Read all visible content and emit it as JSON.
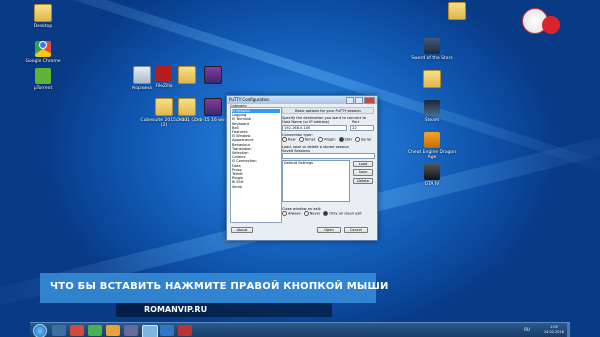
{
  "desktop": {
    "icons": [
      {
        "glyph": "folder",
        "label": "Desktop"
      },
      {
        "glyph": "chrome",
        "label": "Google Chrome"
      },
      {
        "glyph": "utorrent",
        "label": "µTorrent"
      },
      {
        "glyph": "filezilla",
        "label": "FileZilla"
      },
      {
        "glyph": "folder",
        "label": ""
      },
      {
        "glyph": "winrar",
        "label": ""
      },
      {
        "glyph": "folder",
        "label": "Cubesuite 2015.7-13 (2)"
      },
      {
        "glyph": "folder",
        "label": "ceb01 (2)"
      },
      {
        "glyph": "winrar",
        "label": "ceb-15 16 win32"
      },
      {
        "glyph": "recycle",
        "label": "Корзина"
      },
      {
        "glyph": "folder",
        "label": ""
      },
      {
        "glyph": "sword",
        "label": "Sword of the Stars"
      },
      {
        "glyph": "folder",
        "label": ""
      },
      {
        "glyph": "steam",
        "label": "Steam"
      },
      {
        "glyph": "orange",
        "label": "Cheat Engine Dragon Age"
      },
      {
        "glyph": "dark",
        "label": "GTA IV"
      }
    ]
  },
  "putty": {
    "title": "PuTTY Configuration",
    "category_label": "Category:",
    "tree": [
      "⊟ Session",
      "  Logging",
      "⊟ Terminal",
      "  Keyboard",
      "  Bell",
      "  Features",
      "⊟ Window",
      "  Appearance",
      "  Behaviour",
      "  Translation",
      "  Selection",
      "  Colours",
      "⊟ Connection",
      "  Data",
      "  Proxy",
      "  Telnet",
      "  Rlogin",
      "⊞ SSH",
      "  Serial"
    ],
    "header": "Basic options for your PuTTY session",
    "dest_label": "Specify the destination you want to connect to",
    "host_label": "Host Name (or IP address)",
    "port_label": "Port",
    "host_value": "192.168.0.100",
    "port_value": "22",
    "conn_type_label": "Connection type:",
    "conn_types": [
      "Raw",
      "Telnet",
      "Rlogin",
      "SSH",
      "Serial"
    ],
    "selected_conn_type": "SSH",
    "load_label": "Load, save or delete a stored session",
    "saved_label": "Saved Sessions",
    "sessions": [
      "Default Settings"
    ],
    "btn_load": "Load",
    "btn_save": "Save",
    "btn_delete": "Delete",
    "close_label": "Close window on exit:",
    "close_opts": [
      "Always",
      "Never",
      "Only on clean exit"
    ],
    "selected_close_opt": "Only on clean exit",
    "btn_about": "About",
    "btn_open": "Open",
    "btn_cancel": "Cancel"
  },
  "banner": {
    "text": "ЧТО БЫ ВСТАВИТЬ НАЖМИТЕ ПРАВОЙ КНОПКОЙ МЫШИ",
    "subtext": "ROMANVIP.RU"
  },
  "taskbar": {
    "time": "1:05",
    "date": "24.02.2016",
    "lang": "RU"
  }
}
